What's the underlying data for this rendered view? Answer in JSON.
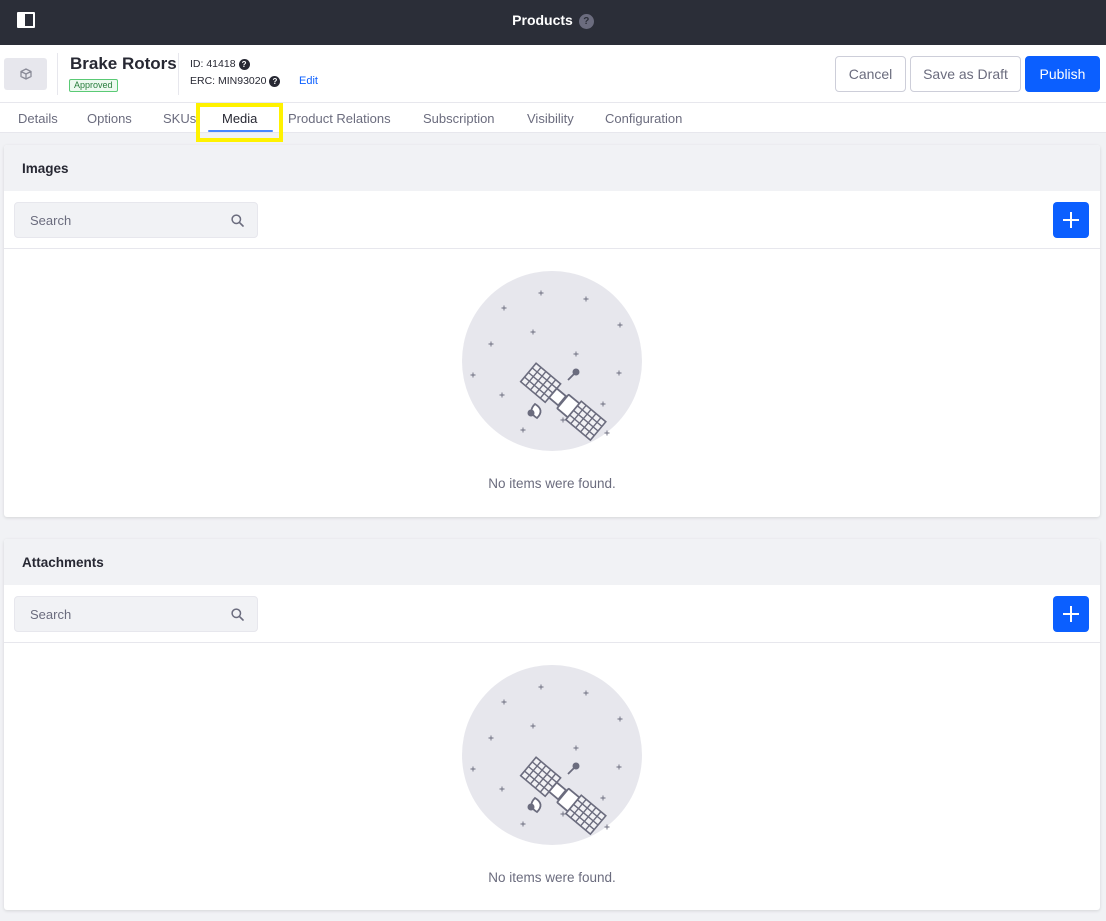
{
  "topbar": {
    "title": "Products",
    "help_glyph": "?"
  },
  "product": {
    "name": "Brake Rotors",
    "status": "Approved",
    "id_label": "ID: 41418",
    "erc_label": "ERC: MIN93020",
    "help_glyph": "?",
    "edit_label": "Edit"
  },
  "actions": {
    "cancel": "Cancel",
    "save_draft": "Save as Draft",
    "publish": "Publish"
  },
  "tabs": [
    {
      "label": "Details"
    },
    {
      "label": "Options"
    },
    {
      "label": "SKUs"
    },
    {
      "label": "Media",
      "active": true
    },
    {
      "label": "Product Relations"
    },
    {
      "label": "Subscription"
    },
    {
      "label": "Visibility"
    },
    {
      "label": "Configuration"
    }
  ],
  "images": {
    "title": "Images",
    "search_placeholder": "Search",
    "empty_message": "No items were found."
  },
  "attachments": {
    "title": "Attachments",
    "search_placeholder": "Search",
    "empty_message": "No items were found."
  },
  "colors": {
    "primary": "#0b5fff",
    "topbar": "#2b2e38",
    "highlight": "#fff200",
    "approved": "#287d3c"
  }
}
